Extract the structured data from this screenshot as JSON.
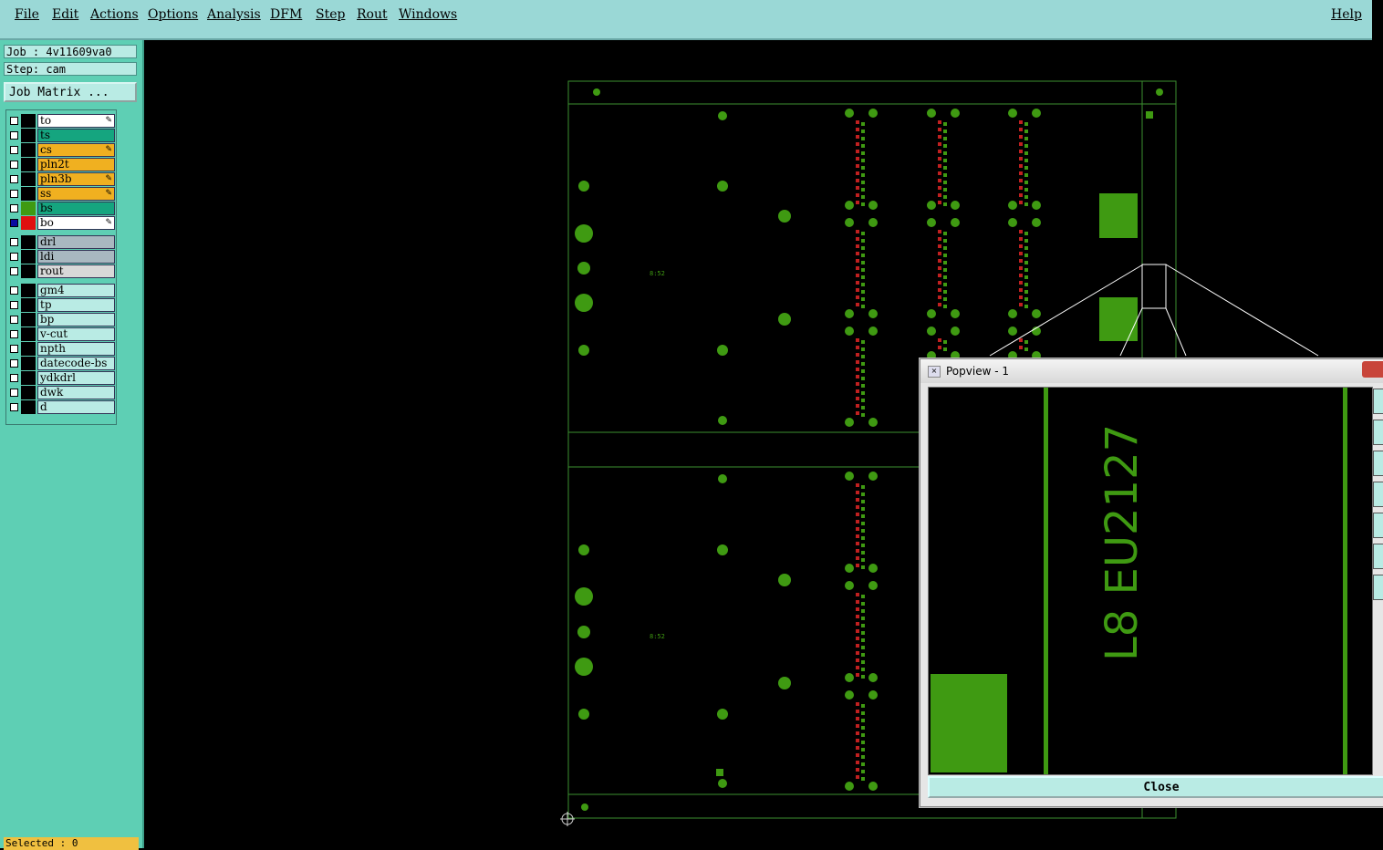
{
  "menu": {
    "items": [
      "File",
      "Edit",
      "Actions",
      "Options",
      "Analysis",
      "DFM",
      "Step",
      "Rout",
      "Windows"
    ],
    "help": "Help"
  },
  "info": {
    "job": "Job : 4v11609va0",
    "step": "Step: cam"
  },
  "job_matrix_label": "Job Matrix ...",
  "layers": [
    {
      "name": "to",
      "color": "#ffffff",
      "icon": "pen"
    },
    {
      "name": "ts",
      "color": "#15a57f",
      "icon": ""
    },
    {
      "name": "cs",
      "color": "#f0b020",
      "icon": "pen"
    },
    {
      "name": "pln2t",
      "color": "#f0b020",
      "icon": ""
    },
    {
      "name": "pln3b",
      "color": "#f0b020",
      "icon": "pen"
    },
    {
      "name": "ss",
      "color": "#f0b020",
      "icon": "pen"
    },
    {
      "name": "bs",
      "color": "#15a57f",
      "icon": ""
    },
    {
      "name": "bo",
      "color": "#ffffff",
      "icon": "pen"
    },
    {
      "name": "drl",
      "color": "#a8b8c0",
      "icon": ""
    },
    {
      "name": "ldi",
      "color": "#a8b8c0",
      "icon": ""
    },
    {
      "name": "rout",
      "color": "#d8d8d8",
      "icon": ""
    },
    {
      "name": "gm4",
      "color": "#b9ebe4",
      "icon": ""
    },
    {
      "name": "tp",
      "color": "#b9ebe4",
      "icon": ""
    },
    {
      "name": "bp",
      "color": "#b9ebe4",
      "icon": ""
    },
    {
      "name": "v-cut",
      "color": "#b9ebe4",
      "icon": ""
    },
    {
      "name": "npth",
      "color": "#b9ebe4",
      "icon": ""
    },
    {
      "name": "datecode-bs",
      "color": "#b9ebe4",
      "icon": ""
    },
    {
      "name": "ydkdrl",
      "color": "#b9ebe4",
      "icon": ""
    },
    {
      "name": "dwk",
      "color": "#b9ebe4",
      "icon": ""
    },
    {
      "name": "d",
      "color": "#b9ebe4",
      "icon": ""
    }
  ],
  "selected": "Selected : 0",
  "popup": {
    "title": "Popview - 1",
    "text": "L8 EU2127",
    "close_label": "Close"
  },
  "board_text": "8:52"
}
